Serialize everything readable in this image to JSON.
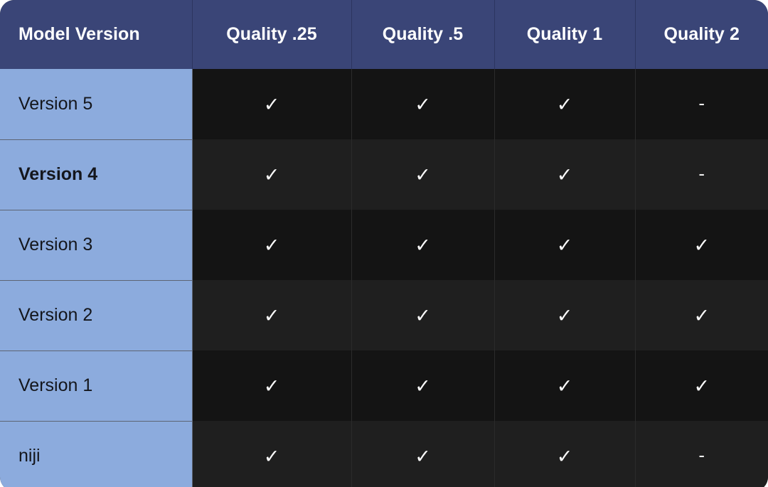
{
  "table": {
    "corner_radius_px": 20,
    "colors": {
      "header_bg": "#3a4577",
      "header_text": "#ffffff",
      "label_col_bg": "#8cabdd",
      "label_col_text": "#14161c",
      "row_bg_dark": "#141414",
      "row_bg_light": "#1f1f1f",
      "value_text": "#fafafa",
      "divider": "#5d6473",
      "page_bg": "#ffffff"
    },
    "columns": [
      {
        "key": "model_version",
        "label": "Model Version",
        "align": "left"
      },
      {
        "key": "quality_025",
        "label": "Quality .25",
        "align": "center"
      },
      {
        "key": "quality_05",
        "label": "Quality .5",
        "align": "center"
      },
      {
        "key": "quality_1",
        "label": "Quality 1",
        "align": "center"
      },
      {
        "key": "quality_2",
        "label": "Quality 2",
        "align": "center"
      }
    ],
    "marks": {
      "supported": "✓",
      "unsupported": "-"
    },
    "rows": [
      {
        "label": "Version 5",
        "bold": false,
        "cells": [
          "✓",
          "✓",
          "✓",
          "-"
        ]
      },
      {
        "label": "Version 4",
        "bold": true,
        "cells": [
          "✓",
          "✓",
          "✓",
          "-"
        ]
      },
      {
        "label": "Version 3",
        "bold": false,
        "cells": [
          "✓",
          "✓",
          "✓",
          "✓"
        ]
      },
      {
        "label": "Version 2",
        "bold": false,
        "cells": [
          "✓",
          "✓",
          "✓",
          "✓"
        ]
      },
      {
        "label": "Version 1",
        "bold": false,
        "cells": [
          "✓",
          "✓",
          "✓",
          "✓"
        ]
      },
      {
        "label": "niji",
        "bold": false,
        "cells": [
          "✓",
          "✓",
          "✓",
          "-"
        ]
      }
    ]
  }
}
